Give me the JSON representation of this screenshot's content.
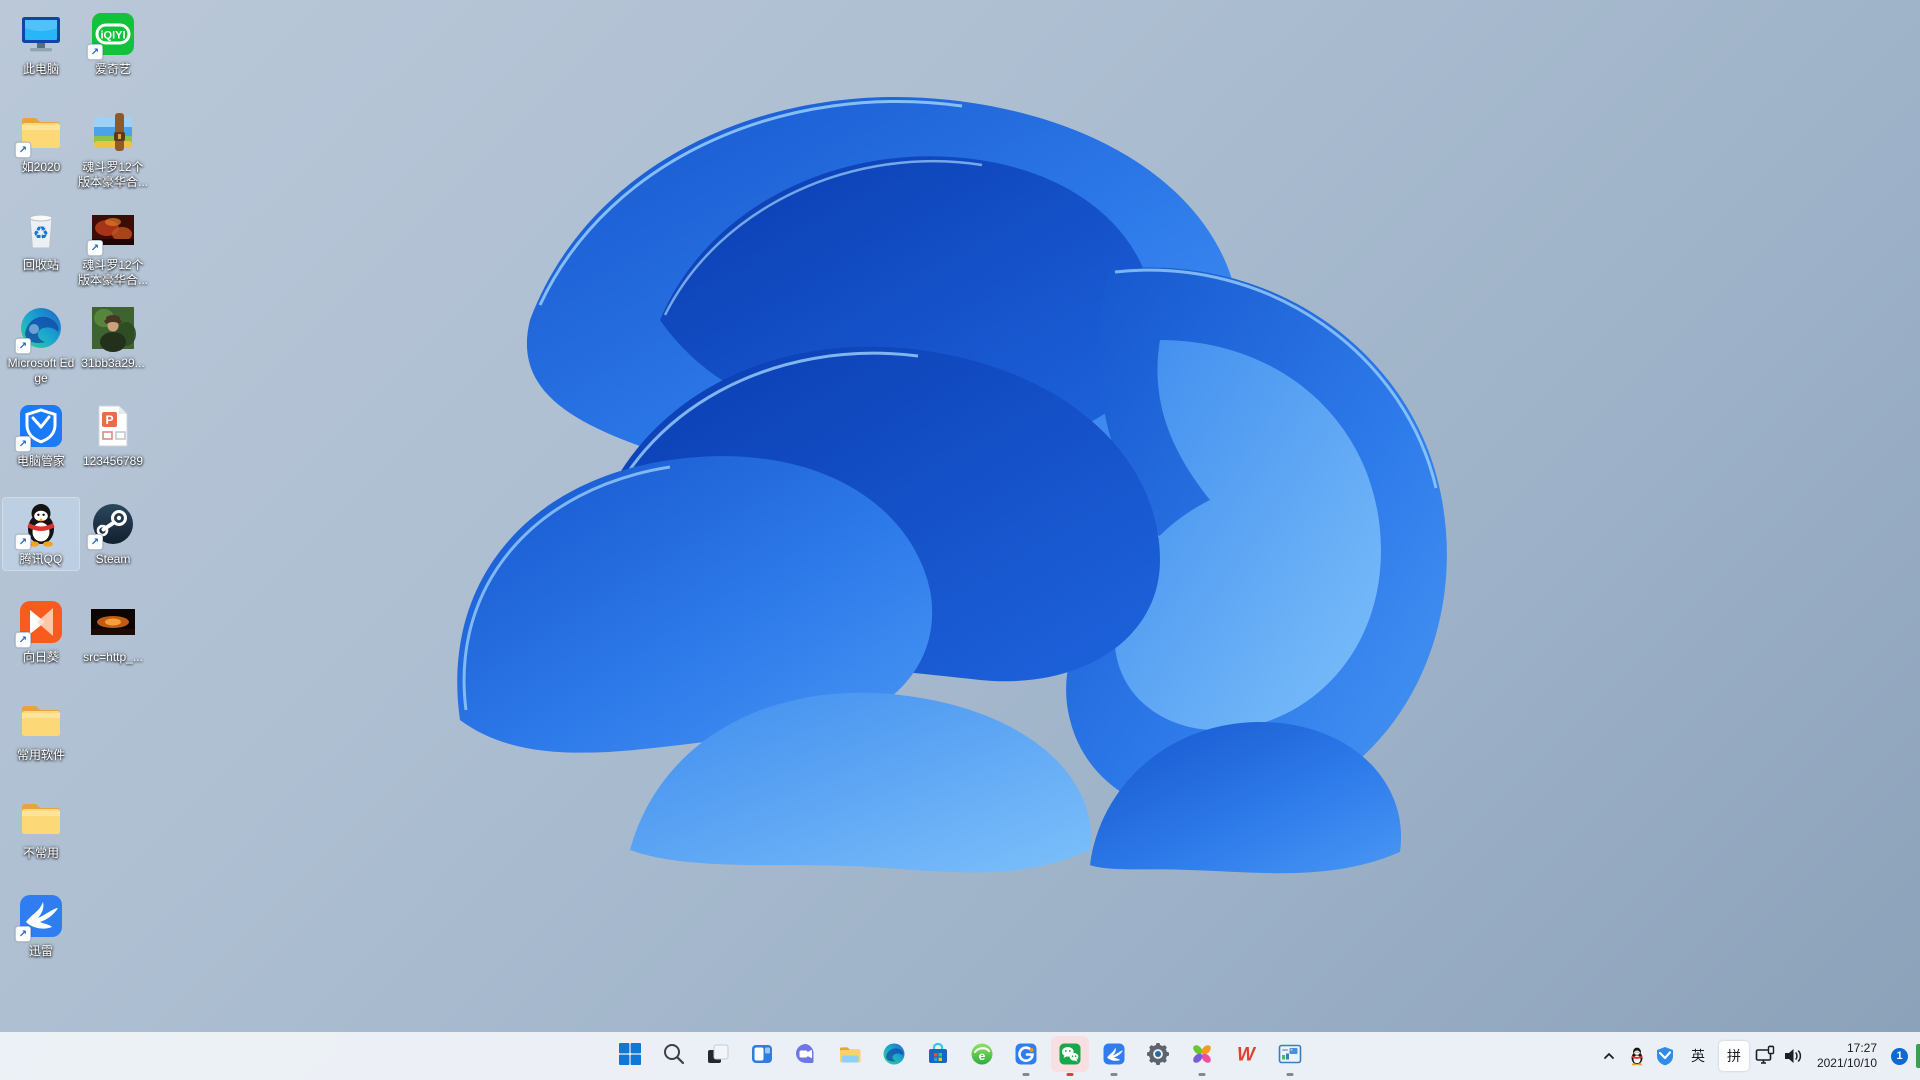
{
  "wallpaper": {
    "name": "windows-11-bloom",
    "bg_top": "#bac8d8",
    "bg_bottom": "#8ba1b9",
    "bloom_deep": "#0a3cb0",
    "bloom_mid": "#1f68e0",
    "bloom_light": "#5ca4f5",
    "bloom_rim": "#a8dcff"
  },
  "desktop": {
    "columns": [
      {
        "items": [
          {
            "label": "此电脑",
            "icon": "this-pc-icon",
            "shortcut": false,
            "selected": false
          },
          {
            "label": "如2020",
            "icon": "folder-icon",
            "shortcut": true,
            "selected": false
          },
          {
            "label": "回收站",
            "icon": "recycle-bin-icon",
            "shortcut": false,
            "selected": false
          },
          {
            "label": "Microsoft Edge",
            "icon": "edge-icon",
            "shortcut": true,
            "selected": false
          },
          {
            "label": "电脑管家",
            "icon": "pc-manager-icon",
            "shortcut": true,
            "selected": false
          },
          {
            "label": "腾讯QQ",
            "icon": "qq-icon",
            "shortcut": true,
            "selected": true
          },
          {
            "label": "向日葵",
            "icon": "sunlogin-icon",
            "shortcut": true,
            "selected": false
          },
          {
            "label": "常用软件",
            "icon": "folder-icon",
            "shortcut": false,
            "selected": false
          },
          {
            "label": "不常用",
            "icon": "folder-icon",
            "shortcut": false,
            "selected": false
          },
          {
            "label": "迅雷",
            "icon": "thunder-icon",
            "shortcut": true,
            "selected": false
          }
        ]
      },
      {
        "items": [
          {
            "label": "爱奇艺",
            "icon": "iqiyi-icon",
            "shortcut": true,
            "selected": false
          },
          {
            "label": "魂斗罗12个版本豪华合...",
            "icon": "rar-archive-icon",
            "shortcut": false,
            "selected": false
          },
          {
            "label": "魂斗罗12个版本豪华合...",
            "icon": "game-image-icon",
            "shortcut": true,
            "selected": false
          },
          {
            "label": "31bb3a29...",
            "icon": "photo-image-icon",
            "shortcut": false,
            "selected": false
          },
          {
            "label": "123456789",
            "icon": "ppt-file-icon",
            "shortcut": false,
            "selected": false
          },
          {
            "label": "Steam",
            "icon": "steam-icon",
            "shortcut": true,
            "selected": false
          },
          {
            "label": "src=http_...",
            "icon": "dark-image-icon",
            "shortcut": false,
            "selected": false
          }
        ]
      }
    ]
  },
  "taskbar": {
    "center_items": [
      {
        "name": "start",
        "icon": "start-icon",
        "running": false,
        "attention": false
      },
      {
        "name": "search",
        "icon": "search-icon",
        "running": false,
        "attention": false
      },
      {
        "name": "task-view",
        "icon": "task-view-icon",
        "running": false,
        "attention": false
      },
      {
        "name": "widgets",
        "icon": "widgets-icon",
        "running": false,
        "attention": false
      },
      {
        "name": "chat",
        "icon": "chat-icon",
        "running": false,
        "attention": false
      },
      {
        "name": "file-explorer",
        "icon": "file-explorer-icon",
        "running": false,
        "attention": false
      },
      {
        "name": "edge-browser",
        "icon": "edge-orb-icon",
        "running": false,
        "attention": false
      },
      {
        "name": "microsoft-store",
        "icon": "store-icon",
        "running": false,
        "attention": false
      },
      {
        "name": "360-browser",
        "icon": "browser-360-icon",
        "running": false,
        "attention": false
      },
      {
        "name": "blue-g-app",
        "icon": "blue-g-icon",
        "running": true,
        "attention": false
      },
      {
        "name": "wechat",
        "icon": "wechat-icon",
        "running": true,
        "attention": true
      },
      {
        "name": "thunder",
        "icon": "thunder-bird-icon",
        "running": true,
        "attention": false
      },
      {
        "name": "settings",
        "icon": "settings-gear-icon",
        "running": false,
        "attention": false
      },
      {
        "name": "pinwheel-app",
        "icon": "pinwheel-icon",
        "running": true,
        "attention": false
      },
      {
        "name": "wps-office",
        "icon": "wps-icon",
        "running": false,
        "attention": false
      },
      {
        "name": "image-viewer",
        "icon": "image-viewer-icon",
        "running": true,
        "attention": false
      }
    ],
    "tray": {
      "ime_lang": "英",
      "ime_mode": "拼"
    },
    "clock": {
      "time": "17:27",
      "date": "2021/10/10"
    },
    "notification_badge": "1"
  }
}
